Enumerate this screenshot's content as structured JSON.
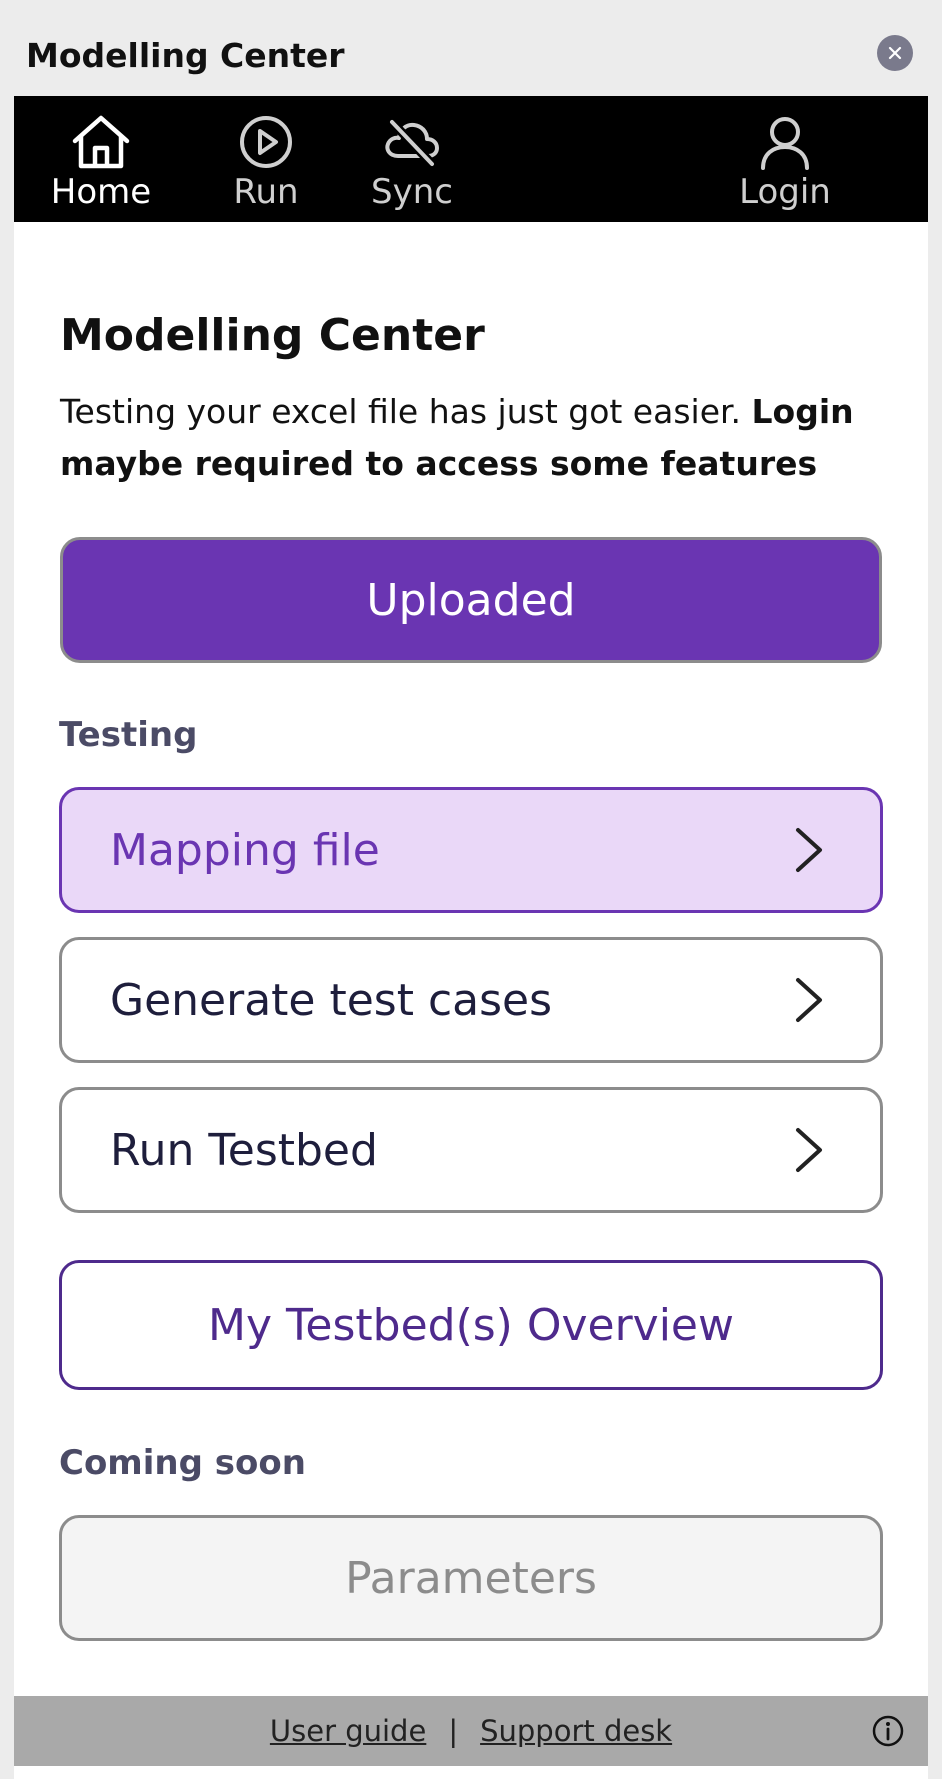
{
  "window": {
    "title": "Modelling Center",
    "close_icon": "close-icon"
  },
  "nav": {
    "items": [
      {
        "label": "Home",
        "icon": "home-icon",
        "active": true
      },
      {
        "label": "Run",
        "icon": "play-circle-icon",
        "active": false
      },
      {
        "label": "Sync",
        "icon": "cloud-off-icon",
        "active": false
      },
      {
        "label": "Login",
        "icon": "user-icon",
        "active": false
      }
    ]
  },
  "main": {
    "title": "Modelling Center",
    "intro_text": "Testing your excel file has just got easier. ",
    "intro_bold": "Login maybe required to access some features",
    "uploaded_label": "Uploaded",
    "testing_label": "Testing",
    "testing_items": [
      {
        "label": "Mapping file",
        "selected": true
      },
      {
        "label": "Generate test cases",
        "selected": false
      },
      {
        "label": "Run Testbed",
        "selected": false
      }
    ],
    "overview_label": "My Testbed(s) Overview",
    "coming_soon_label": "Coming soon",
    "parameters_label": "Parameters"
  },
  "footer": {
    "user_guide": "User guide",
    "separator": "|",
    "support_desk": "Support desk",
    "info_icon": "info-icon"
  },
  "colors": {
    "accent": "#6a35b2",
    "selected_bg": "#ead8f8",
    "nav_bg": "#000000",
    "footer_bg": "#a9a9a9",
    "overview_text": "#4e2a8c"
  }
}
